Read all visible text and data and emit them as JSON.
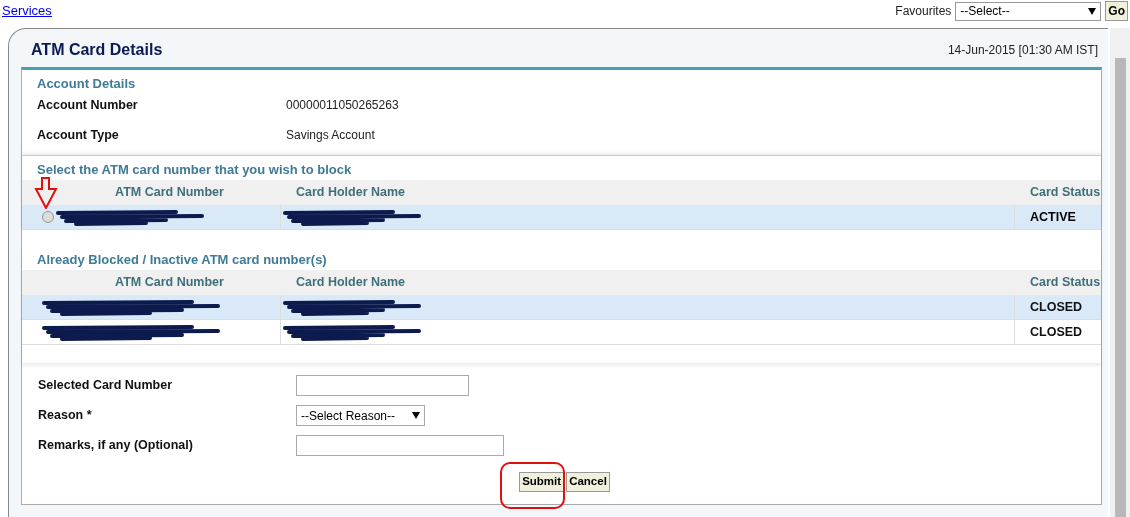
{
  "top_link": "Services",
  "favourites": {
    "label": "Favourites",
    "value": "--Select--",
    "button": "Go"
  },
  "panel": {
    "title": "ATM Card Details",
    "timestamp": "14-Jun-2015 [01:30 AM IST]"
  },
  "account": {
    "heading": "Account Details",
    "fields": [
      {
        "label": "Account Number",
        "value": "00000011050265263"
      },
      {
        "label": "Account Type",
        "value": "Savings Account"
      }
    ]
  },
  "active_cards": {
    "heading": "Select the ATM card number that you wish to block",
    "columns": [
      "ATM Card Number",
      "Card Holder Name",
      "Card Status"
    ],
    "rows": [
      {
        "selected": false,
        "status": "ACTIVE"
      }
    ]
  },
  "blocked_cards": {
    "heading": "Already Blocked / Inactive ATM card number(s)",
    "columns": [
      "ATM Card Number",
      "Card Holder Name",
      "Card Status"
    ],
    "rows": [
      {
        "status": "CLOSED"
      },
      {
        "status": "CLOSED"
      }
    ]
  },
  "form": {
    "fields": [
      {
        "kind": "text",
        "label": "Selected Card Number"
      },
      {
        "kind": "select",
        "label": "Reason *",
        "value": "--Select Reason--"
      },
      {
        "kind": "text",
        "label": "Remarks, if any (Optional)"
      }
    ]
  },
  "buttons": [
    "Submit",
    "Cancel"
  ]
}
